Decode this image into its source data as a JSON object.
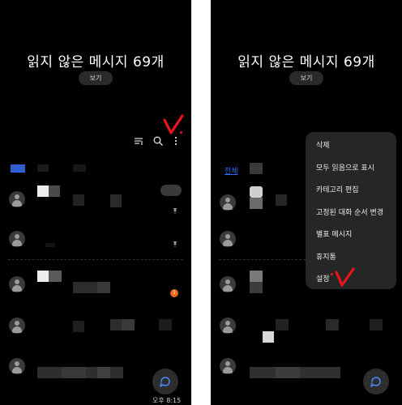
{
  "header": {
    "unread_title": "읽지 않은 메시지 69개",
    "view_button": "보기"
  },
  "left": {
    "filter_label": "전체",
    "badge_count": "1",
    "time": "오후 8:15"
  },
  "right": {
    "filter_label": "전체",
    "menu": {
      "items": [
        "삭제",
        "모두 읽음으로 표시",
        "카테고리 편집",
        "고정된 대화 순서 변경",
        "별표 메시지",
        "휴지통",
        "설정"
      ]
    }
  },
  "icons": {
    "filter": "filter-icon",
    "search": "search-icon",
    "more": "more-vertical-icon",
    "pin": "pin-icon",
    "compose": "compose-icon",
    "annotation": "red-check-mark"
  },
  "colors": {
    "background": "#000000",
    "accent": "#2f6bff",
    "badge": "#e86a1a",
    "annotation": "#e8151b",
    "menu": "#262626"
  }
}
